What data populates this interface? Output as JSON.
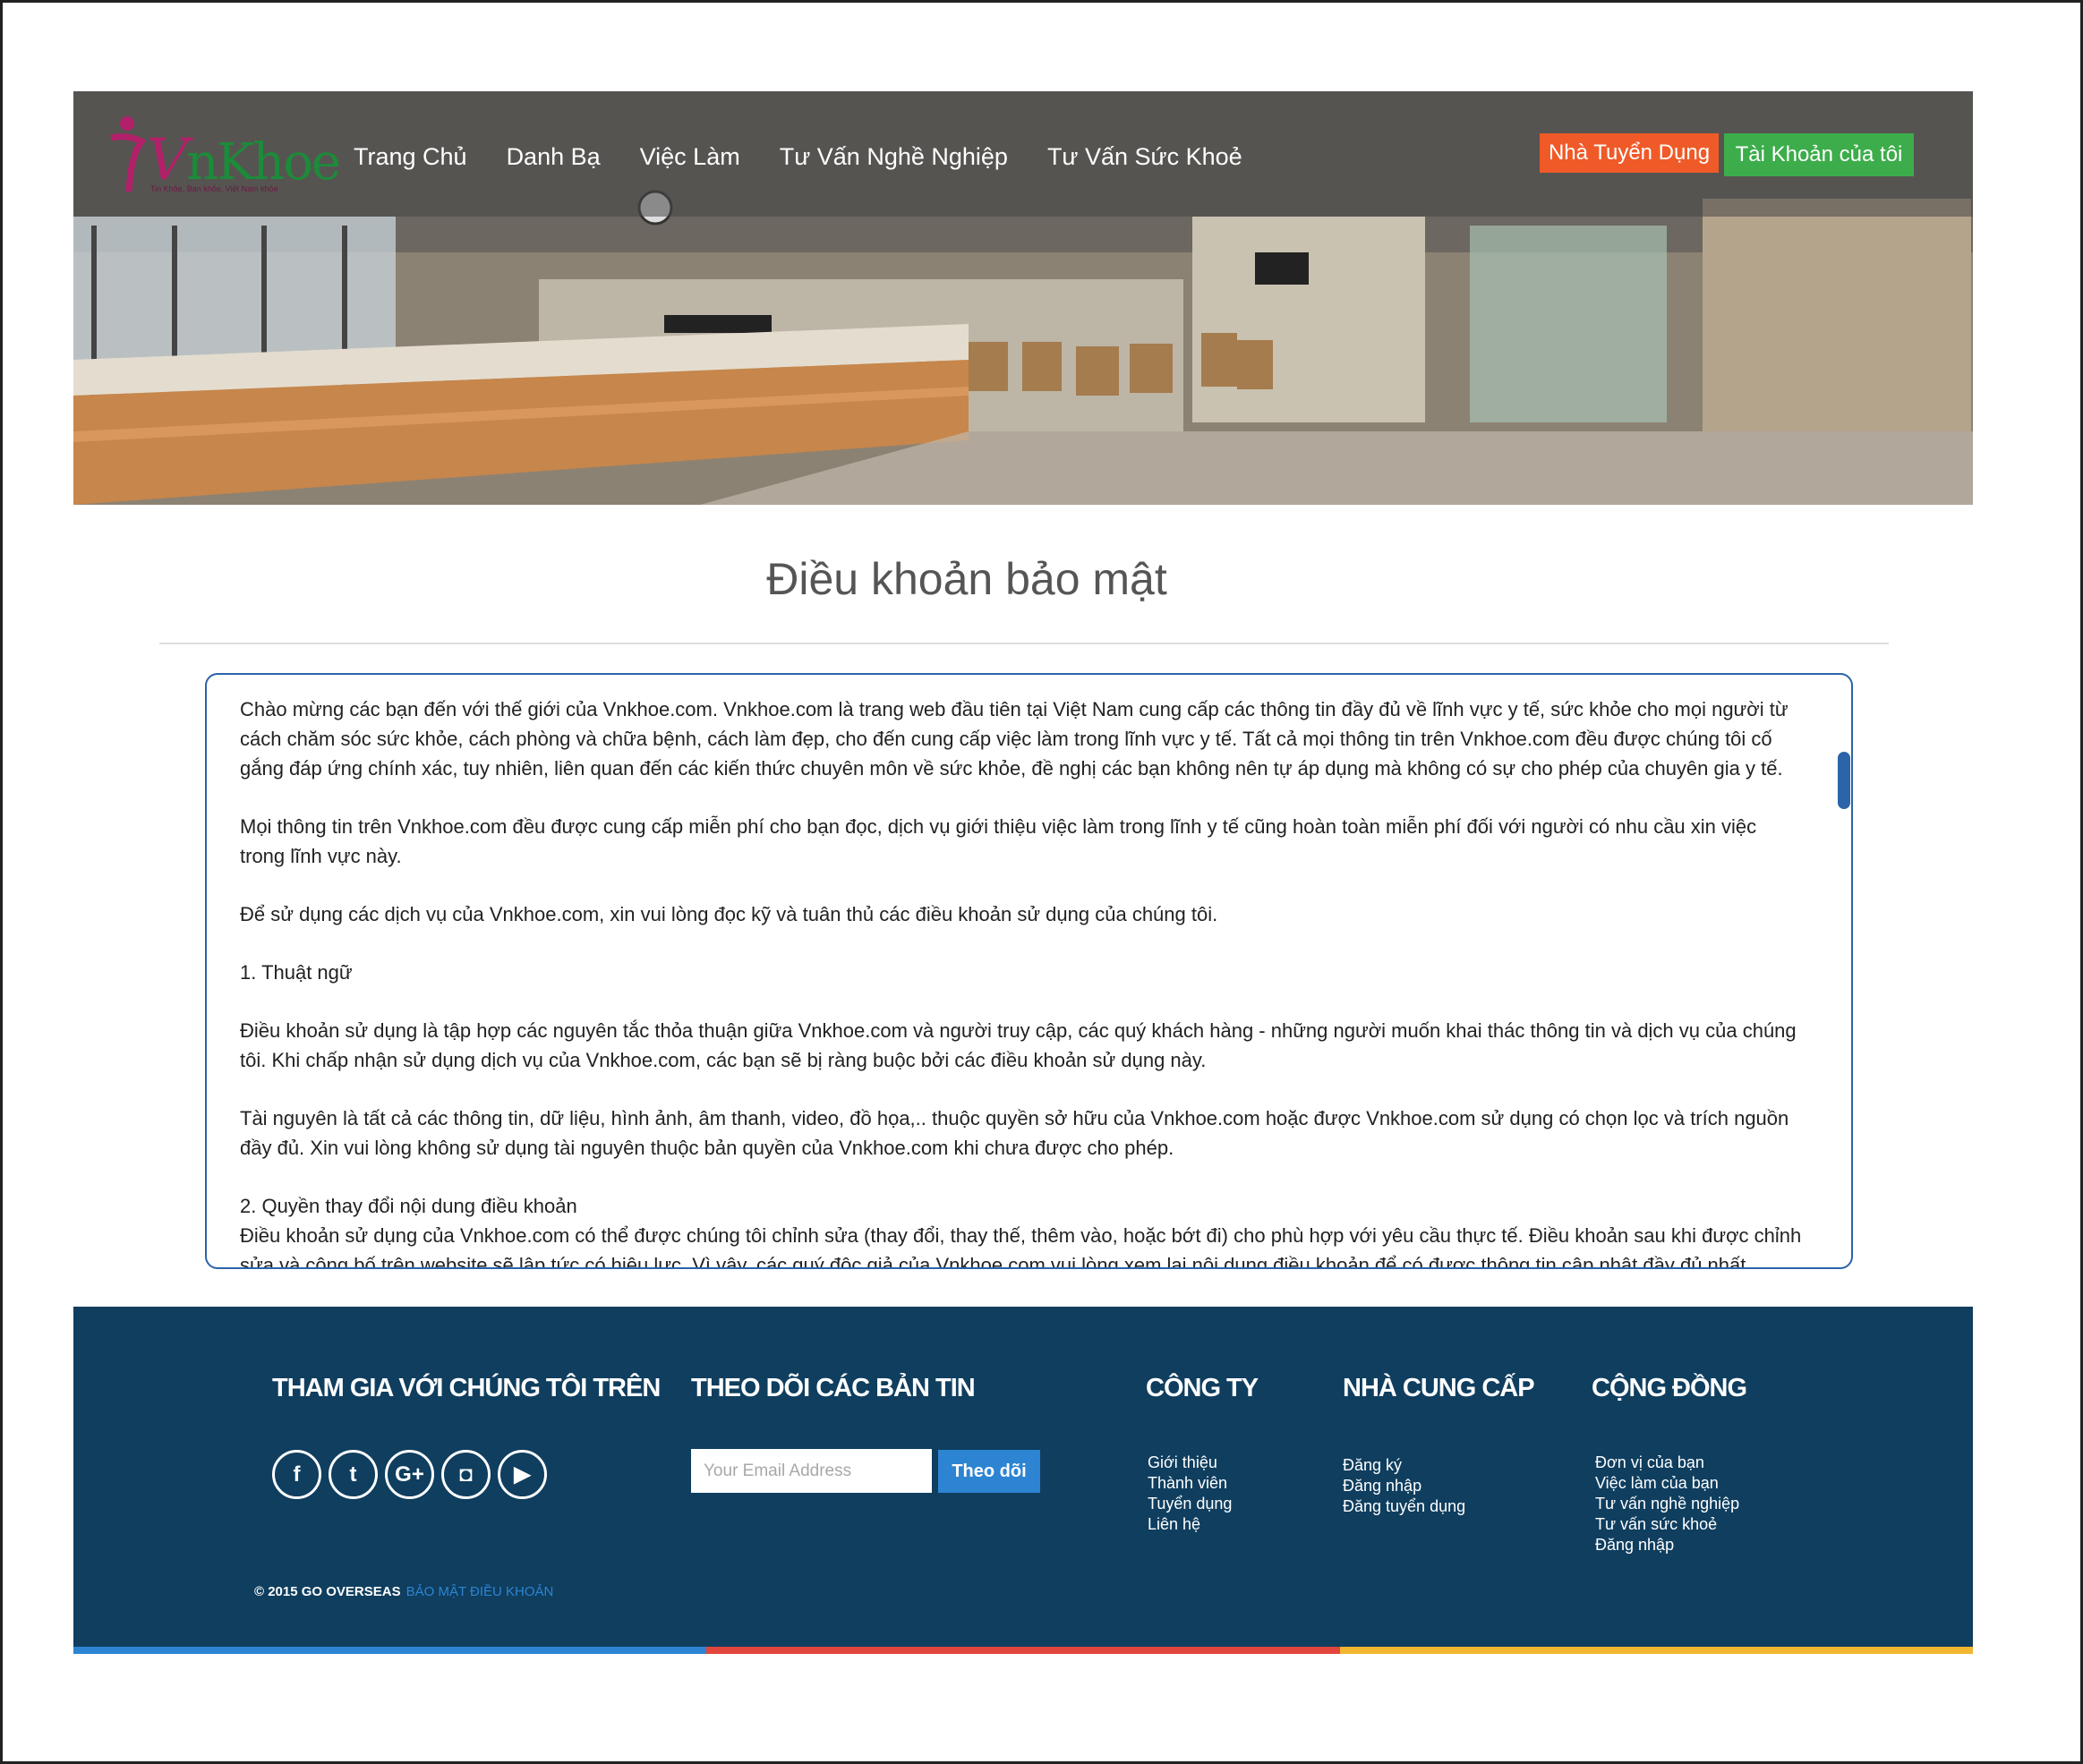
{
  "brand": {
    "logo_text": "VnKhoe",
    "logo_tagline": "Tin Khỏe, Bạn khỏe, Việt Nam khỏe"
  },
  "nav": {
    "items": [
      {
        "label": "Trang Chủ"
      },
      {
        "label": "Danh Bạ"
      },
      {
        "label": "Việc Làm"
      },
      {
        "label": "Tư Vấn Nghề Nghiệp"
      },
      {
        "label": "Tư Vấn Sức Khoẻ"
      }
    ],
    "employer_button": "Nhà Tuyển Dụng",
    "account_button": "Tài Khoản của tôi"
  },
  "main": {
    "title": "Điều khoản bảo mật",
    "paragraphs": [
      "Chào mừng các bạn đến với thế giới của Vnkhoe.com. Vnkhoe.com là trang web đầu tiên tại Việt Nam cung cấp các thông tin đầy đủ về lĩnh vực y tế, sức khỏe cho mọi người từ cách chăm sóc sức khỏe, cách phòng và chữa bệnh, cách làm đẹp, cho đến cung cấp việc làm trong lĩnh vực y tế. Tất cả mọi thông tin trên Vnkhoe.com đều được chúng tôi cố gắng đáp ứng chính xác, tuy nhiên, liên quan đến các kiến thức chuyên môn về sức khỏe, đề nghị các bạn không nên tự áp dụng mà không có sự cho phép của chuyên gia y tế.",
      " Mọi thông tin trên Vnkhoe.com đều được cung cấp miễn phí cho bạn đọc, dịch vụ giới thiệu việc làm trong lĩnh y tế cũng hoàn toàn miễn phí đối với người có nhu cầu xin việc trong lĩnh vực này.",
      " Để sử dụng các dịch vụ của Vnkhoe.com, xin vui lòng đọc kỹ và tuân thủ các điều khoản sử dụng của chúng tôi.",
      "1. Thuật ngữ",
      " Điều khoản sử dụng là tập hợp các nguyên tắc thỏa thuận giữa Vnkhoe.com và người truy cập, các quý khách hàng -  những người muốn khai thác thông tin và dịch vụ của chúng tôi. Khi chấp nhận sử dụng dịch vụ của Vnkhoe.com, các bạn sẽ bị ràng buộc bởi các điều khoản sử dụng này.",
      " Tài nguyên là tất cả các thông tin, dữ liệu, hình ảnh, âm thanh, video, đồ họa,.. thuộc quyền sở hữu của Vnkhoe.com hoặc được Vnkhoe.com sử dụng có chọn lọc và trích nguồn đầy đủ. Xin vui lòng không sử dụng tài nguyên thuộc bản quyền của Vnkhoe.com khi chưa được cho phép.",
      "2. Quyền thay đổi nội dung điều khoản",
      " Điều khoản sử dụng của Vnkhoe.com có thể được chúng tôi chỉnh sửa (thay đổi, thay thế, thêm vào, hoặc bớt đi) cho phù hợp với yêu cầu thực tế. Điều khoản sau khi được chỉnh sửa và công bố trên website sẽ lập tức có hiệu lực. Vì vậy, các quý độc giả của Vnkhoe.com vui lòng xem lại nội dung điều khoản để có được thông tin cập nhật đầy đủ nhất."
    ]
  },
  "footer": {
    "social_heading": "THAM GIA VỚI CHÚNG TÔI TRÊN",
    "social_icons": [
      {
        "icon": "facebook-icon",
        "glyph": "f"
      },
      {
        "icon": "twitter-icon",
        "glyph": "t"
      },
      {
        "icon": "google-plus-icon",
        "glyph": "G+"
      },
      {
        "icon": "instagram-icon",
        "glyph": "◘"
      },
      {
        "icon": "youtube-icon",
        "glyph": "▶"
      }
    ],
    "newsletter_heading": "THEO DÕI CÁC BẢN TIN",
    "email_placeholder": "Your Email Address",
    "subscribe_label": "Theo dõi",
    "company_heading": "CÔNG TY",
    "company_links": [
      "Giới thiệu",
      "Thành viên",
      "Tuyển dụng",
      "Liên hệ"
    ],
    "supplier_heading": "NHÀ CUNG CẤP",
    "supplier_links": [
      "Đăng ký",
      "Đăng nhập",
      "Đăng tuyển dụng"
    ],
    "community_heading": "CỘNG ĐỒNG",
    "community_links": [
      "Đơn vị của bạn",
      "Việc làm của bạn",
      "Tư vấn nghề nghiệp",
      "Tư vấn sức khoẻ",
      "Đăng nhập"
    ],
    "copyright": "© 2015 GO OVERSEAS",
    "legal_links": "BẢO MẬT ĐIỀU KHOẢN",
    "stripe_colors": [
      "#2d84d2",
      "#e2453c",
      "#f2b630"
    ]
  },
  "colors": {
    "accent_orange": "#ef5a28",
    "accent_green": "#3cad4a",
    "footer_bg": "#0f3e5f",
    "box_border": "#2b64a8"
  }
}
